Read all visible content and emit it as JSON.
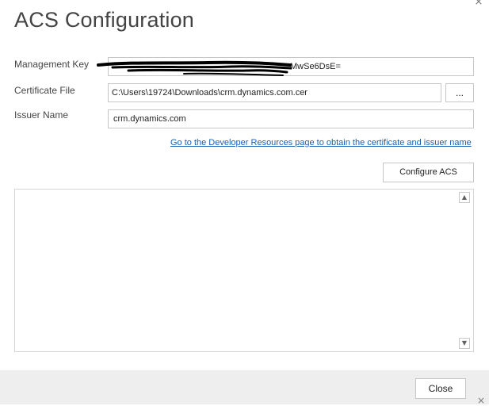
{
  "dialog": {
    "title": "ACS Configuration",
    "close_glyph": "×"
  },
  "form": {
    "management_key": {
      "label": "Management Key",
      "value": "MwSe6DsE="
    },
    "certificate_file": {
      "label": "Certificate File",
      "value": "C:\\Users\\19724\\Downloads\\crm.dynamics.com.cer",
      "browse_label": "..."
    },
    "issuer_name": {
      "label": "Issuer Name",
      "value": "crm.dynamics.com"
    },
    "developer_link": "Go to the Developer Resources page to obtain the certificate and issuer name",
    "configure_label": "Configure ACS"
  },
  "output": {
    "text": "",
    "scroll_up": "▲",
    "scroll_down": "▼"
  },
  "footer": {
    "close_label": "Close",
    "corner_glyph": "×"
  },
  "colors": {
    "link": "#1a5fb4",
    "footer_background": "#eeeeee",
    "border": "#c6c6c6"
  }
}
